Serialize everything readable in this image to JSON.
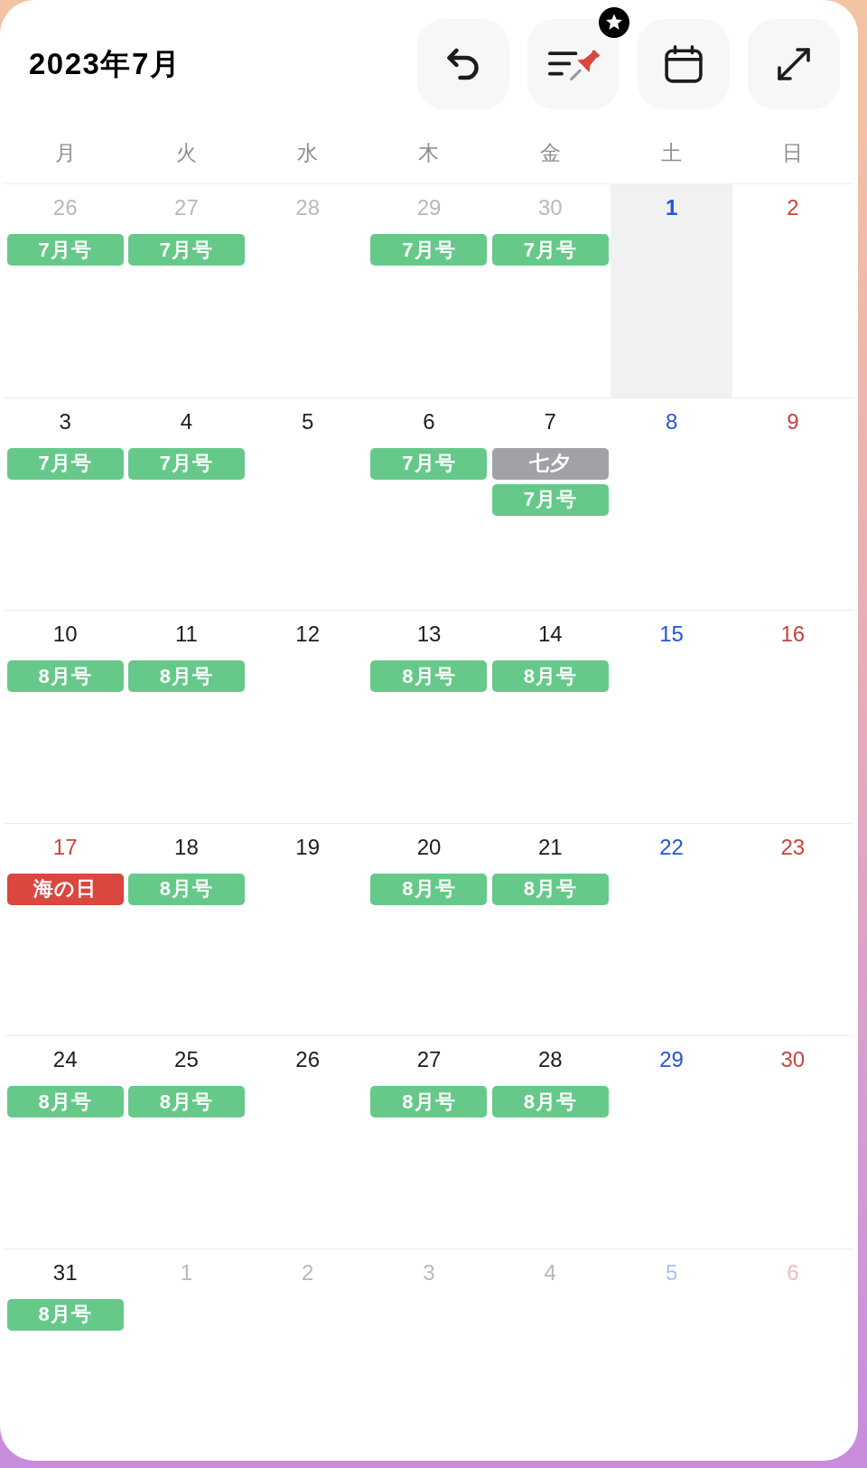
{
  "header": {
    "title": "2023年7月",
    "buttons": [
      {
        "kind": "undo",
        "badge": false
      },
      {
        "kind": "pin-list",
        "badge": true
      },
      {
        "kind": "calendar",
        "badge": false
      },
      {
        "kind": "expand",
        "badge": false
      }
    ]
  },
  "weekdays": [
    "月",
    "火",
    "水",
    "木",
    "金",
    "土",
    "日"
  ],
  "weeks": [
    {
      "days": [
        {
          "date": "26",
          "kind": "weekday",
          "in_month": false,
          "selected": false,
          "events": [
            {
              "label": "7月号",
              "color": "#66c98a"
            }
          ]
        },
        {
          "date": "27",
          "kind": "weekday",
          "in_month": false,
          "selected": false,
          "events": [
            {
              "label": "7月号",
              "color": "#66c98a"
            }
          ]
        },
        {
          "date": "28",
          "kind": "weekday",
          "in_month": false,
          "selected": false
        },
        {
          "date": "29",
          "kind": "weekday",
          "in_month": false,
          "selected": false,
          "events": [
            {
              "label": "7月号",
              "color": "#66c98a"
            }
          ]
        },
        {
          "date": "30",
          "kind": "weekday",
          "in_month": false,
          "selected": false,
          "events": [
            {
              "label": "7月号",
              "color": "#66c98a"
            }
          ]
        },
        {
          "date": "1",
          "kind": "saturday",
          "in_month": true,
          "selected": true
        },
        {
          "date": "2",
          "kind": "sunday",
          "in_month": true,
          "selected": false
        }
      ]
    },
    {
      "days": [
        {
          "date": "3",
          "kind": "weekday",
          "in_month": true,
          "selected": false,
          "events": [
            {
              "label": "7月号",
              "color": "#66c98a"
            }
          ]
        },
        {
          "date": "4",
          "kind": "weekday",
          "in_month": true,
          "selected": false,
          "events": [
            {
              "label": "7月号",
              "color": "#66c98a"
            }
          ]
        },
        {
          "date": "5",
          "kind": "weekday",
          "in_month": true,
          "selected": false
        },
        {
          "date": "6",
          "kind": "weekday",
          "in_month": true,
          "selected": false,
          "events": [
            {
              "label": "7月号",
              "color": "#66c98a"
            }
          ]
        },
        {
          "date": "7",
          "kind": "weekday",
          "in_month": true,
          "selected": false,
          "events": [
            {
              "label": "七夕",
              "color": "#a1a2a6"
            },
            {
              "label": "7月号",
              "color": "#66c98a"
            }
          ]
        },
        {
          "date": "8",
          "kind": "saturday",
          "in_month": true,
          "selected": false
        },
        {
          "date": "9",
          "kind": "sunday",
          "in_month": true,
          "selected": false
        }
      ]
    },
    {
      "days": [
        {
          "date": "10",
          "kind": "weekday",
          "in_month": true,
          "selected": false,
          "events": [
            {
              "label": "8月号",
              "color": "#66c98a"
            }
          ]
        },
        {
          "date": "11",
          "kind": "weekday",
          "in_month": true,
          "selected": false,
          "events": [
            {
              "label": "8月号",
              "color": "#66c98a"
            }
          ]
        },
        {
          "date": "12",
          "kind": "weekday",
          "in_month": true,
          "selected": false
        },
        {
          "date": "13",
          "kind": "weekday",
          "in_month": true,
          "selected": false,
          "events": [
            {
              "label": "8月号",
              "color": "#66c98a"
            }
          ]
        },
        {
          "date": "14",
          "kind": "weekday",
          "in_month": true,
          "selected": false,
          "events": [
            {
              "label": "8月号",
              "color": "#66c98a"
            }
          ]
        },
        {
          "date": "15",
          "kind": "saturday",
          "in_month": true,
          "selected": false
        },
        {
          "date": "16",
          "kind": "sunday",
          "in_month": true,
          "selected": false
        }
      ]
    },
    {
      "days": [
        {
          "date": "17",
          "kind": "holiday",
          "in_month": true,
          "selected": false,
          "events": [
            {
              "label": "海の日",
              "color": "#d9473f"
            }
          ]
        },
        {
          "date": "18",
          "kind": "weekday",
          "in_month": true,
          "selected": false,
          "events": [
            {
              "label": "8月号",
              "color": "#66c98a"
            }
          ]
        },
        {
          "date": "19",
          "kind": "weekday",
          "in_month": true,
          "selected": false
        },
        {
          "date": "20",
          "kind": "weekday",
          "in_month": true,
          "selected": false,
          "events": [
            {
              "label": "8月号",
              "color": "#66c98a"
            }
          ]
        },
        {
          "date": "21",
          "kind": "weekday",
          "in_month": true,
          "selected": false,
          "events": [
            {
              "label": "8月号",
              "color": "#66c98a"
            }
          ]
        },
        {
          "date": "22",
          "kind": "saturday",
          "in_month": true,
          "selected": false
        },
        {
          "date": "23",
          "kind": "sunday",
          "in_month": true,
          "selected": false
        }
      ]
    },
    {
      "days": [
        {
          "date": "24",
          "kind": "weekday",
          "in_month": true,
          "selected": false,
          "events": [
            {
              "label": "8月号",
              "color": "#66c98a"
            }
          ]
        },
        {
          "date": "25",
          "kind": "weekday",
          "in_month": true,
          "selected": false,
          "events": [
            {
              "label": "8月号",
              "color": "#66c98a"
            }
          ]
        },
        {
          "date": "26",
          "kind": "weekday",
          "in_month": true,
          "selected": false
        },
        {
          "date": "27",
          "kind": "weekday",
          "in_month": true,
          "selected": false,
          "events": [
            {
              "label": "8月号",
              "color": "#66c98a"
            }
          ]
        },
        {
          "date": "28",
          "kind": "weekday",
          "in_month": true,
          "selected": false,
          "events": [
            {
              "label": "8月号",
              "color": "#66c98a"
            }
          ]
        },
        {
          "date": "29",
          "kind": "saturday",
          "in_month": true,
          "selected": false
        },
        {
          "date": "30",
          "kind": "sunday",
          "in_month": true,
          "selected": false
        }
      ]
    },
    {
      "days": [
        {
          "date": "31",
          "kind": "weekday",
          "in_month": true,
          "selected": false,
          "events": [
            {
              "label": "8月号",
              "color": "#66c98a"
            }
          ]
        },
        {
          "date": "1",
          "kind": "weekday",
          "in_month": false,
          "selected": false
        },
        {
          "date": "2",
          "kind": "weekday",
          "in_month": false,
          "selected": false
        },
        {
          "date": "3",
          "kind": "weekday",
          "in_month": false,
          "selected": false
        },
        {
          "date": "4",
          "kind": "weekday",
          "in_month": false,
          "selected": false
        },
        {
          "date": "5",
          "kind": "saturday",
          "in_month": false,
          "selected": false
        },
        {
          "date": "6",
          "kind": "sunday",
          "in_month": false,
          "selected": false
        }
      ]
    }
  ]
}
